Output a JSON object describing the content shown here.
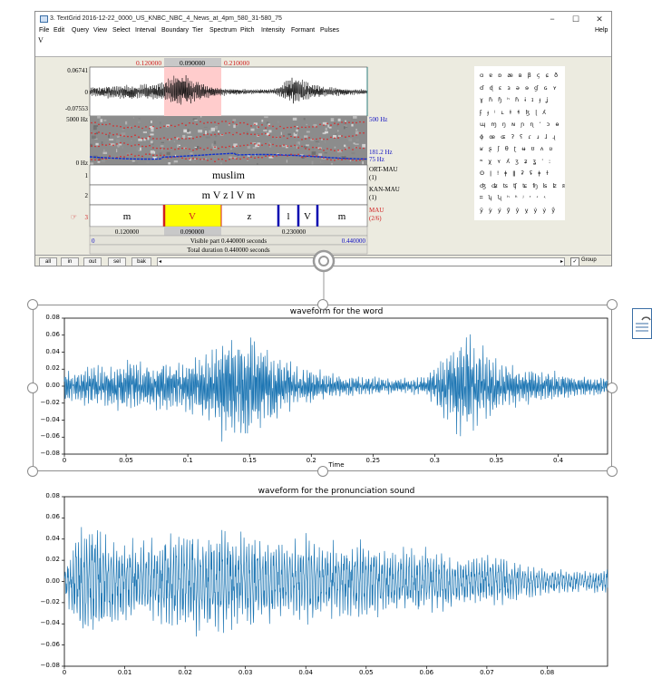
{
  "window": {
    "title": "3. TextGrid 2016-12-22_0000_US_KNBC_NBC_4_News_at_4pm_580_31-580_75",
    "menus": [
      "File",
      "Edit",
      "Query",
      "View",
      "Select",
      "Interval",
      "Boundary",
      "Tier",
      "Spectrum",
      "Pitch",
      "Intensity",
      "Formant",
      "Pulses"
    ],
    "help": "Help",
    "edit_text": "V",
    "buttons": {
      "minimize": "−",
      "maximize": "☐",
      "close": "✕"
    }
  },
  "editor": {
    "sel_left": "0.120000",
    "sel_mid": "0.090000",
    "sel_right": "0.210000",
    "wave_ymax": "0.06741",
    "wave_zero": "0",
    "wave_ymin": "-0.07553",
    "spec_top": "5000 Hz",
    "spec_bottom": "0 Hz",
    "spec_right_top": "500 Hz",
    "pitch_current": "181.2 Hz",
    "pitch_bottom": "75 Hz",
    "tiers": [
      {
        "num": "1",
        "name": "ORT-MAU",
        "count": "(1)",
        "label": "muslim"
      },
      {
        "num": "2",
        "name": "KAN-MAU",
        "count": "(1)",
        "label": "m V z l V m"
      },
      {
        "num": "3",
        "name": "MAU",
        "count": "(2/6)",
        "arrow": "☞"
      }
    ],
    "mau_segments": [
      "m",
      "V",
      "z",
      "l",
      "V",
      "m"
    ],
    "dur_left": "0.120000",
    "dur_mid": "0.090000",
    "dur_right": "0.230000",
    "vis_start": "0",
    "visible": "Visible part 0.440000 seconds",
    "vis_end": "0.440000",
    "total": "Total duration 0.440000 seconds",
    "zoom_buttons": [
      "all",
      "in",
      "out",
      "sel",
      "bak"
    ],
    "scroll_left": "◂",
    "scroll_right": "▸",
    "group_check": "✓",
    "group_label": "Group"
  },
  "ipa_chart": [
    "ɑ ɐ ɒ æ ʙ β ç ɕ ð",
    "ɗ ɖ ɛ ɜ ə ɘ ɠ ɢ ʏ",
    "ɣ ɦ ɧ ʰ ɦ ɨ ɪ ɟ ʝ",
    "ʄ ɟ ʲ ʟ ɫ ɬ ɮ ɭ ʎ",
    "ɰ ɱ ŋ ɴ ɲ ɳ ʼ ɔ ɵ",
    "ɸ œ ɶ ʔ ʕ ɾ ɹ ɺ ɻ",
    "ʁ ʂ ʃ θ ʈ ʉ ʊ ʌ ʋ",
    "ʷ χ ʏ ʎ ʒ ʑ ʓ ˈ ː",
    "ʘ ǀ ǃ ǂ ǁ ʡ ʢ ǂ ɫ",
    "ʤ ʥ ʦ ʧ ʨ ʩ ʪ ʫ ʬ",
    "ʭ ʮ ʯ ʰ ʱ ʲ ʳ ʴ ʵ",
    "ÿ ỳ ý ỹ ŷ ỵ ỷ ẏ ẙ"
  ],
  "colors": {
    "waveform": "#1f77b4",
    "selection": "#ffcccc",
    "cursor_red": "#d02020",
    "boundary_blue": "#0000b0",
    "highlight": "#ffff00",
    "pitch": "#1030d0",
    "formant": "#e02020"
  },
  "chart_data": [
    {
      "type": "line",
      "title": "waveform for the word",
      "xlabel": "Time",
      "ylabel": "",
      "xlim": [
        0,
        0.44
      ],
      "ylim": [
        -0.08,
        0.08
      ],
      "xticks": [
        "0",
        "0.05",
        "0.1",
        "0.15",
        "0.2",
        "0.25",
        "0.3",
        "0.35",
        "0.4"
      ],
      "yticks": [
        "0.08",
        "0.06",
        "0.04",
        "0.02",
        "0.00",
        "−0.02",
        "−0.04",
        "−0.06",
        "−0.08"
      ],
      "envelope": {
        "x": [
          0,
          0.03,
          0.06,
          0.09,
          0.11,
          0.12,
          0.13,
          0.145,
          0.16,
          0.18,
          0.19,
          0.2,
          0.22,
          0.25,
          0.27,
          0.29,
          0.305,
          0.315,
          0.325,
          0.335,
          0.345,
          0.36,
          0.38,
          0.4,
          0.42,
          0.44
        ],
        "amp": [
          0.018,
          0.026,
          0.03,
          0.03,
          0.034,
          0.045,
          0.062,
          0.068,
          0.056,
          0.035,
          0.024,
          0.02,
          0.013,
          0.011,
          0.009,
          0.01,
          0.03,
          0.05,
          0.062,
          0.05,
          0.035,
          0.024,
          0.02,
          0.016,
          0.012,
          0.01
        ]
      }
    },
    {
      "type": "line",
      "title": "waveform for the pronunciation sound",
      "xlabel": "",
      "ylabel": "",
      "xlim": [
        0,
        0.09
      ],
      "ylim": [
        -0.08,
        0.08
      ],
      "xticks": [
        "0",
        "0.01",
        "0.02",
        "0.03",
        "0.04",
        "0.05",
        "0.06",
        "0.07",
        "0.08"
      ],
      "yticks": [
        "0.08",
        "0.06",
        "0.04",
        "0.02",
        "0.00",
        "−0.02",
        "−0.04",
        "−0.06",
        "−0.08"
      ],
      "envelope": {
        "x": [
          0,
          0.002,
          0.003,
          0.006,
          0.01,
          0.015,
          0.02,
          0.025,
          0.03,
          0.035,
          0.04,
          0.045,
          0.05,
          0.055,
          0.06,
          0.065,
          0.07,
          0.075,
          0.08,
          0.085,
          0.09
        ],
        "amp": [
          0.01,
          0.05,
          0.07,
          0.05,
          0.035,
          0.04,
          0.045,
          0.05,
          0.045,
          0.04,
          0.042,
          0.035,
          0.038,
          0.03,
          0.032,
          0.025,
          0.025,
          0.018,
          0.012,
          0.01,
          0.012
        ]
      }
    }
  ]
}
